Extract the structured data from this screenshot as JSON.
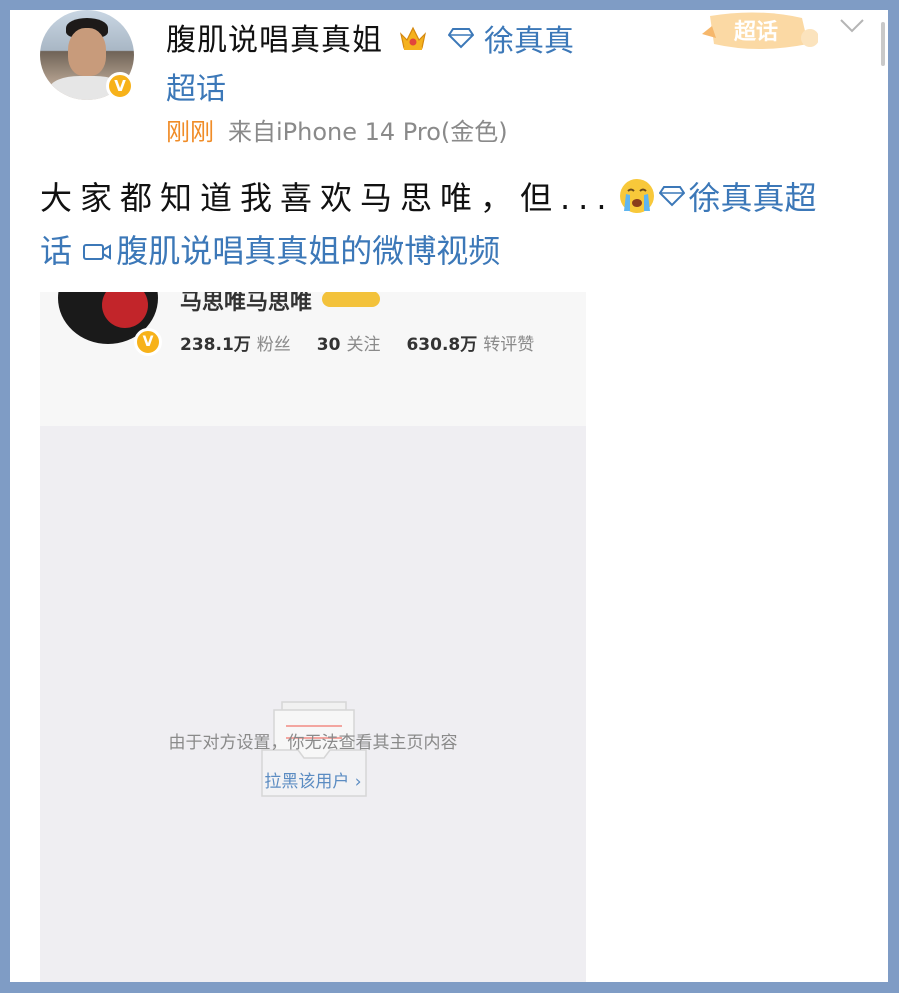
{
  "post": {
    "username": "腹肌说唱真真姐",
    "topic_name_part1": "徐真真",
    "topic_name_part2": "超话",
    "chaohua_badge": "超话",
    "time": "刚刚",
    "source": "来自iPhone 14 Pro(金色)",
    "text_lead": "大家都知道我喜欢马思唯，但...",
    "text_topic_a": "徐真真超",
    "text_topic_b": "话",
    "text_video_link": "腹肌说唱真真姐的微博视频"
  },
  "embedded_profile": {
    "name": "马思唯马思唯",
    "followers_value": "238.1万",
    "followers_label": "粉丝",
    "following_value": "30",
    "following_label": "关注",
    "likes_value": "630.8万",
    "likes_label": "转评赞",
    "empty_message": "由于对方设置，你无法查看其主页内容",
    "block_link": "拉黑该用户 ›"
  },
  "colors": {
    "link_blue": "#3c78b8",
    "time_orange": "#f08c27",
    "verified_gold": "#f7b21a",
    "frame_blue": "#7f9cc5"
  },
  "icons": [
    "crown-icon",
    "diamond-topic-icon",
    "chevron-down-icon",
    "crying-emoji-icon",
    "video-camera-icon",
    "verified-badge-icon",
    "empty-inbox-icon"
  ]
}
